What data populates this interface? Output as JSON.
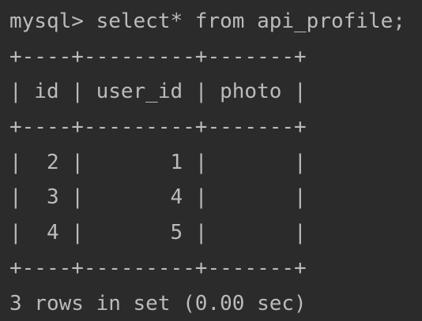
{
  "terminal": {
    "lines": [
      "mysql> select* from api_profile;",
      "+----+---------+-------+",
      "| id | user_id | photo |",
      "+----+---------+-------+",
      "|  2 |       1 |       |",
      "|  3 |       4 |       |",
      "|  4 |       5 |       |",
      "+----+---------+-------+",
      "3 rows in set (0.00 sec)"
    ]
  },
  "colors": {
    "background": "#2b2b2b",
    "text": "#bbbbbb"
  }
}
